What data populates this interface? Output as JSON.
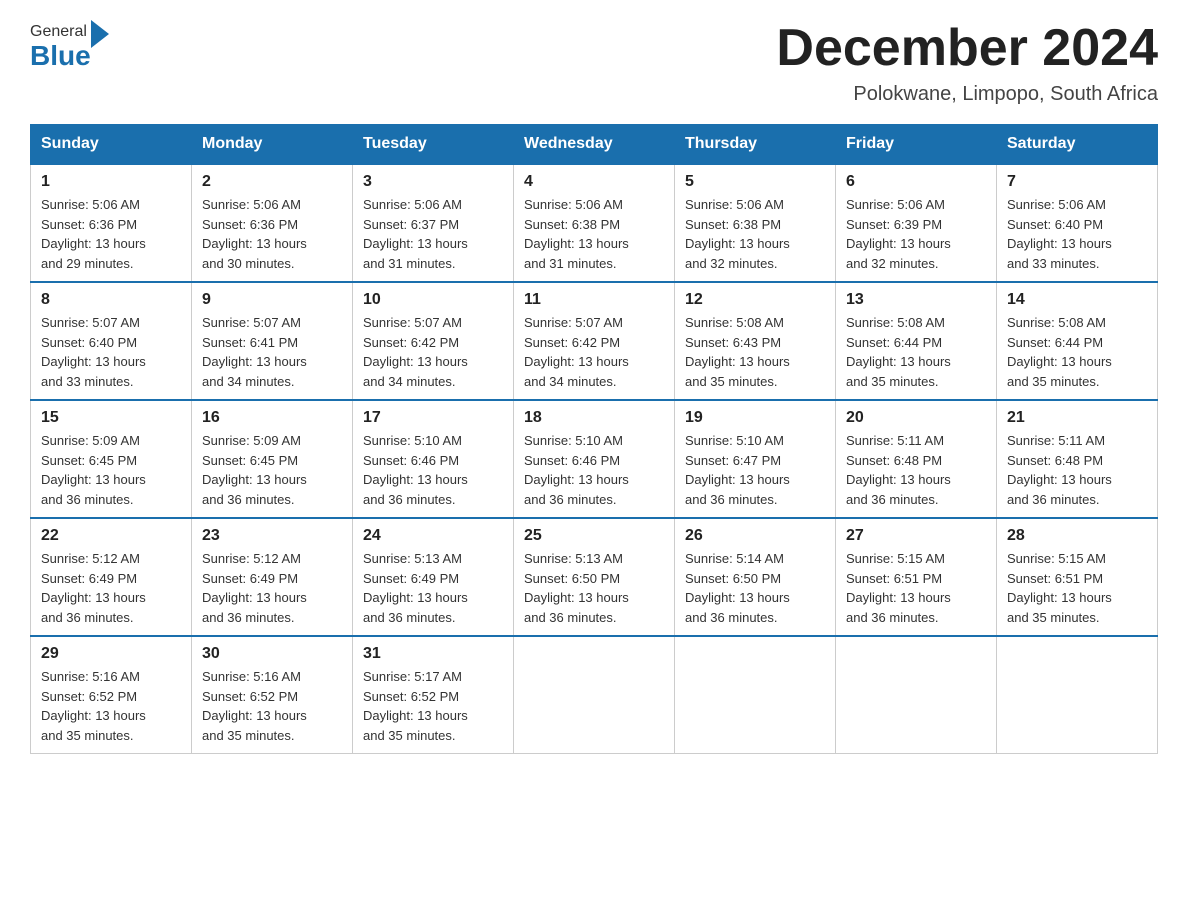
{
  "header": {
    "logo_general": "General",
    "logo_blue": "Blue",
    "month_title": "December 2024",
    "location": "Polokwane, Limpopo, South Africa"
  },
  "days_of_week": [
    "Sunday",
    "Monday",
    "Tuesday",
    "Wednesday",
    "Thursday",
    "Friday",
    "Saturday"
  ],
  "weeks": [
    [
      {
        "day": "1",
        "sunrise": "5:06 AM",
        "sunset": "6:36 PM",
        "daylight": "13 hours and 29 minutes."
      },
      {
        "day": "2",
        "sunrise": "5:06 AM",
        "sunset": "6:36 PM",
        "daylight": "13 hours and 30 minutes."
      },
      {
        "day": "3",
        "sunrise": "5:06 AM",
        "sunset": "6:37 PM",
        "daylight": "13 hours and 31 minutes."
      },
      {
        "day": "4",
        "sunrise": "5:06 AM",
        "sunset": "6:38 PM",
        "daylight": "13 hours and 31 minutes."
      },
      {
        "day": "5",
        "sunrise": "5:06 AM",
        "sunset": "6:38 PM",
        "daylight": "13 hours and 32 minutes."
      },
      {
        "day": "6",
        "sunrise": "5:06 AM",
        "sunset": "6:39 PM",
        "daylight": "13 hours and 32 minutes."
      },
      {
        "day": "7",
        "sunrise": "5:06 AM",
        "sunset": "6:40 PM",
        "daylight": "13 hours and 33 minutes."
      }
    ],
    [
      {
        "day": "8",
        "sunrise": "5:07 AM",
        "sunset": "6:40 PM",
        "daylight": "13 hours and 33 minutes."
      },
      {
        "day": "9",
        "sunrise": "5:07 AM",
        "sunset": "6:41 PM",
        "daylight": "13 hours and 34 minutes."
      },
      {
        "day": "10",
        "sunrise": "5:07 AM",
        "sunset": "6:42 PM",
        "daylight": "13 hours and 34 minutes."
      },
      {
        "day": "11",
        "sunrise": "5:07 AM",
        "sunset": "6:42 PM",
        "daylight": "13 hours and 34 minutes."
      },
      {
        "day": "12",
        "sunrise": "5:08 AM",
        "sunset": "6:43 PM",
        "daylight": "13 hours and 35 minutes."
      },
      {
        "day": "13",
        "sunrise": "5:08 AM",
        "sunset": "6:44 PM",
        "daylight": "13 hours and 35 minutes."
      },
      {
        "day": "14",
        "sunrise": "5:08 AM",
        "sunset": "6:44 PM",
        "daylight": "13 hours and 35 minutes."
      }
    ],
    [
      {
        "day": "15",
        "sunrise": "5:09 AM",
        "sunset": "6:45 PM",
        "daylight": "13 hours and 36 minutes."
      },
      {
        "day": "16",
        "sunrise": "5:09 AM",
        "sunset": "6:45 PM",
        "daylight": "13 hours and 36 minutes."
      },
      {
        "day": "17",
        "sunrise": "5:10 AM",
        "sunset": "6:46 PM",
        "daylight": "13 hours and 36 minutes."
      },
      {
        "day": "18",
        "sunrise": "5:10 AM",
        "sunset": "6:46 PM",
        "daylight": "13 hours and 36 minutes."
      },
      {
        "day": "19",
        "sunrise": "5:10 AM",
        "sunset": "6:47 PM",
        "daylight": "13 hours and 36 minutes."
      },
      {
        "day": "20",
        "sunrise": "5:11 AM",
        "sunset": "6:48 PM",
        "daylight": "13 hours and 36 minutes."
      },
      {
        "day": "21",
        "sunrise": "5:11 AM",
        "sunset": "6:48 PM",
        "daylight": "13 hours and 36 minutes."
      }
    ],
    [
      {
        "day": "22",
        "sunrise": "5:12 AM",
        "sunset": "6:49 PM",
        "daylight": "13 hours and 36 minutes."
      },
      {
        "day": "23",
        "sunrise": "5:12 AM",
        "sunset": "6:49 PM",
        "daylight": "13 hours and 36 minutes."
      },
      {
        "day": "24",
        "sunrise": "5:13 AM",
        "sunset": "6:49 PM",
        "daylight": "13 hours and 36 minutes."
      },
      {
        "day": "25",
        "sunrise": "5:13 AM",
        "sunset": "6:50 PM",
        "daylight": "13 hours and 36 minutes."
      },
      {
        "day": "26",
        "sunrise": "5:14 AM",
        "sunset": "6:50 PM",
        "daylight": "13 hours and 36 minutes."
      },
      {
        "day": "27",
        "sunrise": "5:15 AM",
        "sunset": "6:51 PM",
        "daylight": "13 hours and 36 minutes."
      },
      {
        "day": "28",
        "sunrise": "5:15 AM",
        "sunset": "6:51 PM",
        "daylight": "13 hours and 35 minutes."
      }
    ],
    [
      {
        "day": "29",
        "sunrise": "5:16 AM",
        "sunset": "6:52 PM",
        "daylight": "13 hours and 35 minutes."
      },
      {
        "day": "30",
        "sunrise": "5:16 AM",
        "sunset": "6:52 PM",
        "daylight": "13 hours and 35 minutes."
      },
      {
        "day": "31",
        "sunrise": "5:17 AM",
        "sunset": "6:52 PM",
        "daylight": "13 hours and 35 minutes."
      },
      null,
      null,
      null,
      null
    ]
  ],
  "labels": {
    "sunrise_prefix": "Sunrise: ",
    "sunset_prefix": "Sunset: ",
    "daylight_prefix": "Daylight: "
  }
}
